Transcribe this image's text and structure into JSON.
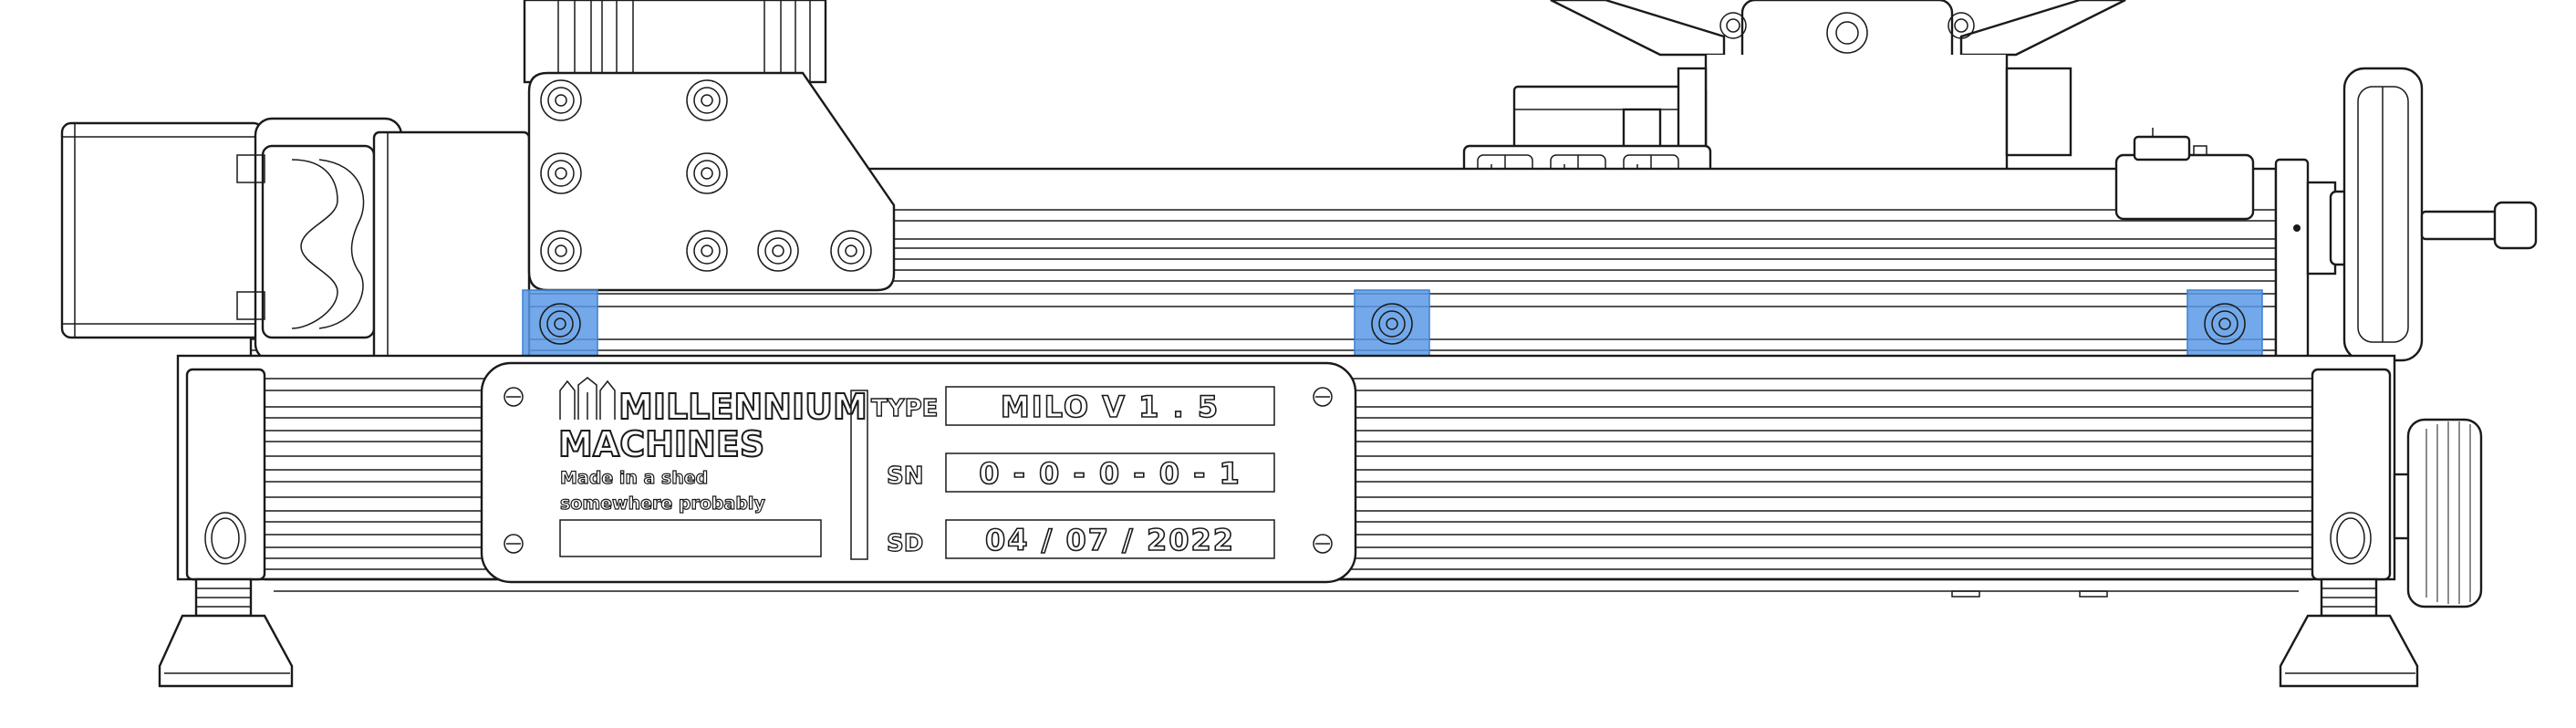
{
  "nameplate": {
    "brand_line1": "MILLENNIUM",
    "brand_line2": "MACHINES",
    "tagline_line1": "Made in a shed",
    "tagline_line2": "somewhere probably",
    "fields": [
      {
        "label": "TYPE",
        "value": "MILO V 1 . 5"
      },
      {
        "label": "SN",
        "value": "0 - 0 - 0 - 0 - 1"
      },
      {
        "label": "SD",
        "value": "04 / 07 / 2022"
      }
    ]
  },
  "colors": {
    "line": "#1a1a1a",
    "background": "#ffffff",
    "highlight": "#5b9ae6"
  },
  "highlighted_fasteners": 3
}
